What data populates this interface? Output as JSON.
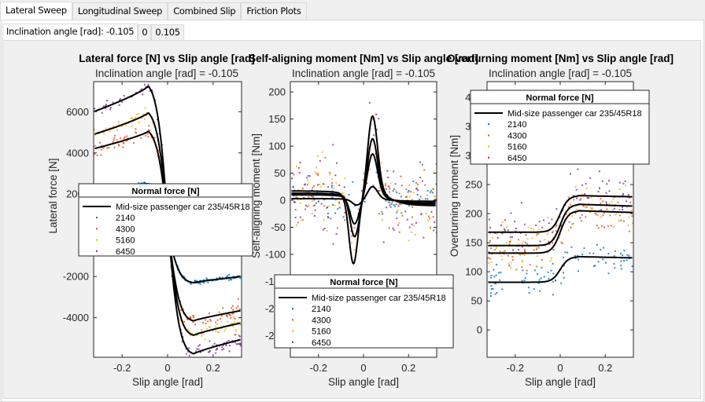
{
  "tabs": [
    {
      "label": "Lateral Sweep",
      "active": true
    },
    {
      "label": "Longitudinal Sweep",
      "active": false
    },
    {
      "label": "Combined Slip",
      "active": false
    },
    {
      "label": "Friction Plots",
      "active": false
    }
  ],
  "subtabs": [
    {
      "label": "Inclination angle [rad]: -0.105",
      "active": true
    },
    {
      "label": "0",
      "active": false
    },
    {
      "label": "0.105",
      "active": false
    }
  ],
  "colors": {
    "series_2140": "#0072BD",
    "series_4300": "#D95319",
    "series_5160": "#EDB120",
    "series_6450": "#7E2F8E",
    "fit": "#000000"
  },
  "chart_data": [
    {
      "type": "scatter",
      "title": "Lateral force [N] vs Slip angle [rad]",
      "subtitle": "Inclination angle [rad] = -0.105",
      "xlabel": "Slip angle [rad]",
      "ylabel": "Lateral force [N]",
      "xlim": [
        -0.325,
        0.325
      ],
      "ylim": [
        -5920,
        7460
      ],
      "xticks": [
        -0.2,
        0,
        0.2
      ],
      "xticklabels": [
        "-0.2",
        "0",
        "0.2"
      ],
      "yticks": [
        -4000,
        -2000,
        0,
        2000,
        4000,
        6000
      ],
      "yticklabels": [
        "-4000",
        "-2000",
        "0",
        "2000",
        "4000",
        "6000"
      ],
      "grid": false,
      "legend": {
        "title": "Normal force [N]",
        "placement": "center-left",
        "entries": [
          "Mid-size passenger car 235/45R18",
          "2140",
          "4300",
          "5160",
          "6450"
        ]
      },
      "series": [
        {
          "name": "2140",
          "fit": {
            "peak": 2500,
            "peak_x": -0.09,
            "trough": -2300,
            "trough_x": 0.11,
            "end_left": 2400,
            "end_right": -2000
          },
          "scatter_range": [
            -0.13,
            0.32
          ],
          "noise": 60
        },
        {
          "name": "4300",
          "fit": {
            "peak": 5050,
            "peak_x": -0.09,
            "trough": -4150,
            "trough_x": 0.11,
            "end_left": 4200,
            "end_right": -3650
          },
          "scatter_range": [
            -0.33,
            0.33
          ],
          "noise": 250
        },
        {
          "name": "5160",
          "fit": {
            "peak": 5950,
            "peak_x": -0.09,
            "trough": -4850,
            "trough_x": 0.11,
            "end_left": 4900,
            "end_right": -4250
          },
          "scatter_range": [
            -0.33,
            0.33
          ],
          "noise": 180
        },
        {
          "name": "6450",
          "fit": {
            "peak": 7250,
            "peak_x": -0.09,
            "trough": -5750,
            "trough_x": 0.11,
            "end_left": 6000,
            "end_right": -5050
          },
          "scatter_range": [
            -0.33,
            0.33
          ],
          "noise": 200
        }
      ]
    },
    {
      "type": "scatter",
      "title": "Self-aligning moment [Nm] vs Slip angle [rad]",
      "subtitle": "Inclination angle [rad] = -0.105",
      "xlabel": "Slip angle [rad]",
      "ylabel": "Self-aligning moment [Nm]",
      "xlim": [
        -0.325,
        0.325
      ],
      "ylim": [
        -290,
        219
      ],
      "xticks": [
        -0.2,
        0,
        0.2
      ],
      "xticklabels": [
        "-0.2",
        "0",
        "0.2"
      ],
      "yticks": [
        -250,
        -200,
        -150,
        -100,
        -50,
        0,
        50,
        100,
        150,
        200
      ],
      "yticklabels": [
        "-250",
        "-200",
        "-150",
        "-100",
        "-50",
        "0",
        "50",
        "100",
        "150",
        "200"
      ],
      "grid": false,
      "legend": {
        "title": "Normal force [N]",
        "placement": "bottom",
        "entries": [
          "Mid-size passenger car 235/45R18",
          "2140",
          "4300",
          "5160",
          "6450"
        ]
      },
      "series": [
        {
          "name": "2140",
          "fit": {
            "max": 25,
            "max_x": 0.04,
            "min": -10,
            "min_x": -0.03,
            "end_left": 3,
            "end_right": -2
          },
          "noise": 25
        },
        {
          "name": "4300",
          "fit": {
            "max": 85,
            "max_x": 0.04,
            "min": -48,
            "min_x": -0.04,
            "end_left": 10,
            "end_right": -5
          },
          "noise": 45
        },
        {
          "name": "5160",
          "fit": {
            "max": 113,
            "max_x": 0.04,
            "min": -73,
            "min_x": -0.04,
            "end_left": 13,
            "end_right": -7
          },
          "noise": 50
        },
        {
          "name": "6450",
          "fit": {
            "max": 155,
            "max_x": 0.04,
            "min": -125,
            "min_x": -0.045,
            "end_left": 17,
            "end_right": -10
          },
          "noise": 55
        }
      ]
    },
    {
      "type": "scatter",
      "title": "Overturning moment [Nm] vs Slip angle [rad]",
      "subtitle": "Inclination angle [rad] = -0.105",
      "xlabel": "Slip angle [rad]",
      "ylabel": "Overturning moment [Nm]",
      "xlim": [
        -0.325,
        0.325
      ],
      "ylim": [
        -47,
        427
      ],
      "xticks": [
        -0.2,
        0,
        0.2
      ],
      "xticklabels": [
        "-0.2",
        "0",
        "0.2"
      ],
      "yticks": [
        0,
        50,
        100,
        150,
        200,
        250,
        300,
        350,
        400
      ],
      "yticklabels": [
        "0",
        "50",
        "100",
        "150",
        "200",
        "250",
        "300",
        "350",
        "400"
      ],
      "grid": false,
      "legend": {
        "title": "Normal force [N]",
        "placement": "top",
        "entries": [
          "Mid-size passenger car 235/45R18",
          "2140",
          "4300",
          "5160",
          "6450"
        ]
      },
      "series": [
        {
          "name": "2140",
          "fit": {
            "left": 82,
            "right_peak": 126,
            "right_end": 124
          },
          "noise": 20
        },
        {
          "name": "4300",
          "fit": {
            "left": 132,
            "right_peak": 205,
            "right_end": 202
          },
          "noise": 25
        },
        {
          "name": "5160",
          "fit": {
            "left": 145,
            "right_peak": 216,
            "right_end": 213
          },
          "noise": 30
        },
        {
          "name": "6450",
          "fit": {
            "left": 168,
            "right_peak": 231,
            "right_end": 229
          },
          "noise": 30
        }
      ]
    }
  ]
}
